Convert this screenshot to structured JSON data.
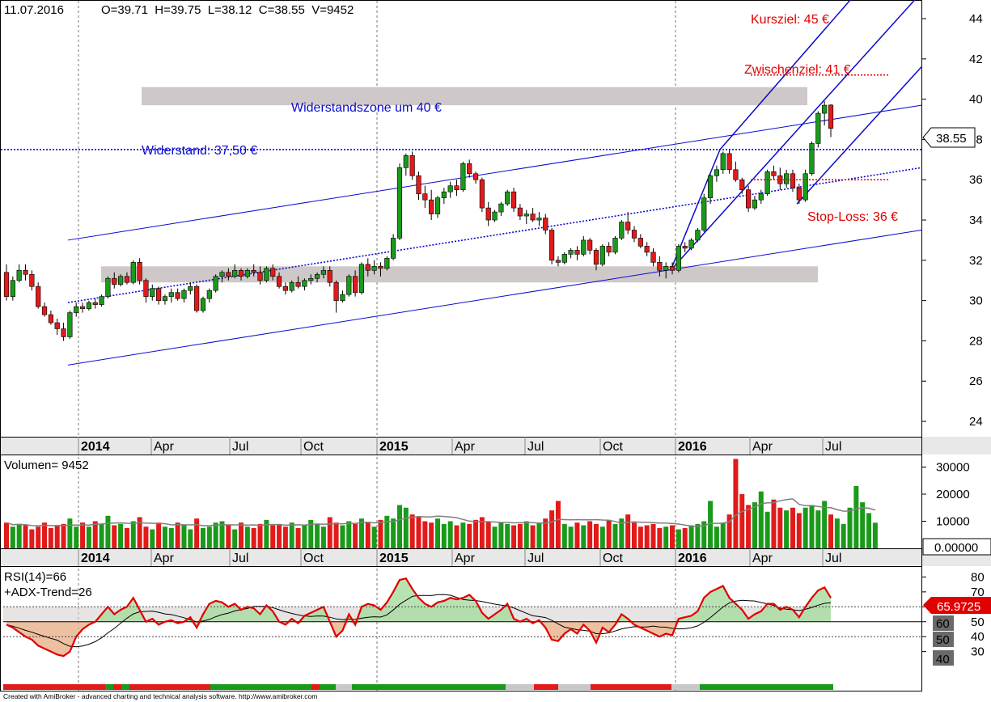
{
  "header": {
    "date": "11.07.2016",
    "ohlcv": "O=39.71  H=39.75  L=38.12  C=38.55  V=9452"
  },
  "annotations": {
    "resistance_zone": "Widerstandszone um 40 €",
    "resistance": "Widerstand: 37,50 €",
    "kursziel": "Kursziel: 45 €",
    "zwischenziel": "Zwischenziel: 41 €",
    "stop_loss": "Stop-Loss: 36 €"
  },
  "last_price_label": "38.55",
  "time_axis": {
    "labels": [
      "2014",
      "Apr",
      "Jul",
      "Oct",
      "2015",
      "Apr",
      "Jul",
      "Oct",
      "2016",
      "Apr",
      "Jul"
    ],
    "bold": [
      true,
      false,
      false,
      false,
      true,
      false,
      false,
      false,
      true,
      false,
      false
    ]
  },
  "volume_panel": {
    "title": "Volumen= 9452",
    "ticks": [
      "30000",
      "20000",
      "10000"
    ],
    "zero_label": "0.00000"
  },
  "rsi_panel": {
    "title_line1": "RSI(14)=66",
    "title_line2": "+ADX-Trend=26",
    "ticks": [
      "80",
      "70",
      "60",
      "50",
      "40",
      "30"
    ],
    "current_value": "65.9725",
    "box_labels": [
      "60",
      "50",
      "40"
    ]
  },
  "footer": "Created with AmiBroker - advanced charting and technical analysis software. http://www.amibroker.com",
  "colors": {
    "up": "#1a9a1a",
    "down": "#e21a1a",
    "channel": "#0a0ad0",
    "annotation_red": "#e00000",
    "zone": "#cfc8c8",
    "rsi": "#e00000"
  },
  "chart_data": {
    "type": "candlestick",
    "price_axis": {
      "ticks": [
        24,
        26,
        28,
        30,
        32,
        34,
        36,
        38,
        40,
        42,
        44
      ],
      "ylim": [
        23,
        45.8
      ],
      "last_close": 38.55
    },
    "ohlc_weekly_approx": [
      [
        31.4,
        31.8,
        30.0,
        30.2
      ],
      [
        30.2,
        31.2,
        30.0,
        31.0
      ],
      [
        31.0,
        31.8,
        30.9,
        31.5
      ],
      [
        31.5,
        31.8,
        31.0,
        31.3
      ],
      [
        31.3,
        31.5,
        30.5,
        30.7
      ],
      [
        30.7,
        30.9,
        29.6,
        29.7
      ],
      [
        29.7,
        29.9,
        29.2,
        29.3
      ],
      [
        29.3,
        29.5,
        28.8,
        28.9
      ],
      [
        28.9,
        29.1,
        28.3,
        28.6
      ],
      [
        28.6,
        28.9,
        28.0,
        28.2
      ],
      [
        28.2,
        29.5,
        28.1,
        29.4
      ],
      [
        29.4,
        29.9,
        29.2,
        29.7
      ],
      [
        29.7,
        29.9,
        29.4,
        29.6
      ],
      [
        29.6,
        30.0,
        29.5,
        29.9
      ],
      [
        29.9,
        30.1,
        29.6,
        29.8
      ],
      [
        29.8,
        30.3,
        29.7,
        30.2
      ],
      [
        30.2,
        31.2,
        30.1,
        31.1
      ],
      [
        31.1,
        31.4,
        30.6,
        30.8
      ],
      [
        30.8,
        31.3,
        30.7,
        31.2
      ],
      [
        31.2,
        31.4,
        30.8,
        30.9
      ],
      [
        30.9,
        32.0,
        30.8,
        31.9
      ],
      [
        31.9,
        32.1,
        30.8,
        31.0
      ],
      [
        31.0,
        31.1,
        29.9,
        30.2
      ],
      [
        30.2,
        30.8,
        30.0,
        30.6
      ],
      [
        30.6,
        30.7,
        29.8,
        30.0
      ],
      [
        30.0,
        30.3,
        29.8,
        30.2
      ],
      [
        30.2,
        30.6,
        29.9,
        30.4
      ],
      [
        30.4,
        30.6,
        30.0,
        30.1
      ],
      [
        30.1,
        30.6,
        29.9,
        30.5
      ],
      [
        30.5,
        30.9,
        30.3,
        30.7
      ],
      [
        30.7,
        30.8,
        29.4,
        29.5
      ],
      [
        29.5,
        30.2,
        29.4,
        30.1
      ],
      [
        30.1,
        30.6,
        29.9,
        30.5
      ],
      [
        30.5,
        31.3,
        30.4,
        31.2
      ],
      [
        31.2,
        31.5,
        30.9,
        31.4
      ],
      [
        31.4,
        31.6,
        31.0,
        31.2
      ],
      [
        31.2,
        31.8,
        31.1,
        31.5
      ],
      [
        31.5,
        31.6,
        31.0,
        31.2
      ],
      [
        31.2,
        31.6,
        31.1,
        31.5
      ],
      [
        31.5,
        31.8,
        31.2,
        31.4
      ],
      [
        31.4,
        31.7,
        30.8,
        31.0
      ],
      [
        31.0,
        31.7,
        30.9,
        31.6
      ],
      [
        31.6,
        31.8,
        31.0,
        31.2
      ],
      [
        31.2,
        31.4,
        30.6,
        30.7
      ],
      [
        30.7,
        30.9,
        30.3,
        30.5
      ],
      [
        30.5,
        31.0,
        30.4,
        30.9
      ],
      [
        30.9,
        31.2,
        30.6,
        30.7
      ],
      [
        30.7,
        31.1,
        30.5,
        31.0
      ],
      [
        31.0,
        31.3,
        30.8,
        31.1
      ],
      [
        31.1,
        31.4,
        30.9,
        31.3
      ],
      [
        31.3,
        31.7,
        31.1,
        31.5
      ],
      [
        31.5,
        31.7,
        30.7,
        30.9
      ],
      [
        30.9,
        31.0,
        29.4,
        30.0
      ],
      [
        30.0,
        30.5,
        29.9,
        30.3
      ],
      [
        30.3,
        31.3,
        30.2,
        31.2
      ],
      [
        31.2,
        31.5,
        30.2,
        30.4
      ],
      [
        30.4,
        31.9,
        30.3,
        31.8
      ],
      [
        31.8,
        32.1,
        31.2,
        31.5
      ],
      [
        31.5,
        32.0,
        31.3,
        31.7
      ],
      [
        31.7,
        31.9,
        31.2,
        31.6
      ],
      [
        31.6,
        32.2,
        31.5,
        32.1
      ],
      [
        32.1,
        33.3,
        32.0,
        33.1
      ],
      [
        33.1,
        36.8,
        33.0,
        36.6
      ],
      [
        36.6,
        37.3,
        36.2,
        37.2
      ],
      [
        37.2,
        37.4,
        36.0,
        36.2
      ],
      [
        36.2,
        36.4,
        35.0,
        35.3
      ],
      [
        35.3,
        35.7,
        34.6,
        35.0
      ],
      [
        35.0,
        35.5,
        34.0,
        34.3
      ],
      [
        34.3,
        35.2,
        34.1,
        35.1
      ],
      [
        35.1,
        35.6,
        34.8,
        35.4
      ],
      [
        35.4,
        35.9,
        35.1,
        35.7
      ],
      [
        35.7,
        36.0,
        35.2,
        35.5
      ],
      [
        35.5,
        36.9,
        35.4,
        36.8
      ],
      [
        36.8,
        37.0,
        36.1,
        36.3
      ],
      [
        36.3,
        36.4,
        35.8,
        36.0
      ],
      [
        36.0,
        36.1,
        34.4,
        34.6
      ],
      [
        34.6,
        34.9,
        33.7,
        34.0
      ],
      [
        34.0,
        34.5,
        33.9,
        34.4
      ],
      [
        34.4,
        34.9,
        34.2,
        34.8
      ],
      [
        34.8,
        35.5,
        34.7,
        35.4
      ],
      [
        35.4,
        35.6,
        34.4,
        34.6
      ],
      [
        34.6,
        34.8,
        34.0,
        34.2
      ],
      [
        34.2,
        34.5,
        33.8,
        34.3
      ],
      [
        34.3,
        34.6,
        33.9,
        34.0
      ],
      [
        34.0,
        34.4,
        33.7,
        34.1
      ],
      [
        34.1,
        34.3,
        33.3,
        33.5
      ],
      [
        33.5,
        33.6,
        31.8,
        32.0
      ],
      [
        32.0,
        32.2,
        31.7,
        31.9
      ],
      [
        31.9,
        32.4,
        31.8,
        32.3
      ],
      [
        32.3,
        32.6,
        32.1,
        32.5
      ],
      [
        32.5,
        32.7,
        32.0,
        32.3
      ],
      [
        32.3,
        33.2,
        32.2,
        33.0
      ],
      [
        33.0,
        33.1,
        32.3,
        32.5
      ],
      [
        32.5,
        32.6,
        31.5,
        31.8
      ],
      [
        31.8,
        32.8,
        31.7,
        32.7
      ],
      [
        32.7,
        32.9,
        32.2,
        32.4
      ],
      [
        32.4,
        33.2,
        32.3,
        33.1
      ],
      [
        33.1,
        34.0,
        33.0,
        33.9
      ],
      [
        33.9,
        34.4,
        33.3,
        33.5
      ],
      [
        33.5,
        33.7,
        32.9,
        33.1
      ],
      [
        33.1,
        33.3,
        32.6,
        32.7
      ],
      [
        32.7,
        32.9,
        32.2,
        32.4
      ],
      [
        32.4,
        32.6,
        31.7,
        31.9
      ],
      [
        31.9,
        32.2,
        31.2,
        31.5
      ],
      [
        31.5,
        31.9,
        31.1,
        31.7
      ],
      [
        31.7,
        31.9,
        31.3,
        31.5
      ],
      [
        31.5,
        32.8,
        31.4,
        32.7
      ],
      [
        32.7,
        32.9,
        32.4,
        32.6
      ],
      [
        32.6,
        33.1,
        32.5,
        33.0
      ],
      [
        33.0,
        33.6,
        32.9,
        33.5
      ],
      [
        33.5,
        35.3,
        33.4,
        35.1
      ],
      [
        35.1,
        36.3,
        34.8,
        36.2
      ],
      [
        36.2,
        36.7,
        35.9,
        36.5
      ],
      [
        36.5,
        37.4,
        36.3,
        37.3
      ],
      [
        37.3,
        37.5,
        36.3,
        36.5
      ],
      [
        36.5,
        36.9,
        35.9,
        36.0
      ],
      [
        36.0,
        36.1,
        35.3,
        35.5
      ],
      [
        35.5,
        35.7,
        34.4,
        34.6
      ],
      [
        34.6,
        35.2,
        34.5,
        35.0
      ],
      [
        35.0,
        35.5,
        34.8,
        35.3
      ],
      [
        35.3,
        36.5,
        35.2,
        36.4
      ],
      [
        36.4,
        36.7,
        36.0,
        36.2
      ],
      [
        36.2,
        36.6,
        35.5,
        35.8
      ],
      [
        35.8,
        36.5,
        35.6,
        36.3
      ],
      [
        36.3,
        36.5,
        35.4,
        35.6
      ],
      [
        35.6,
        35.8,
        34.8,
        35.0
      ],
      [
        35.0,
        36.5,
        34.9,
        36.3
      ],
      [
        36.3,
        37.9,
        36.2,
        37.8
      ],
      [
        37.8,
        39.4,
        37.6,
        39.3
      ],
      [
        39.3,
        39.9,
        38.7,
        39.7
      ],
      [
        39.71,
        39.75,
        38.12,
        38.55
      ]
    ],
    "volume_approx": [
      9500,
      8000,
      9000,
      8500,
      7000,
      8000,
      9500,
      7500,
      8500,
      9000,
      11000,
      8000,
      9500,
      8000,
      10000,
      9000,
      12000,
      8500,
      9000,
      7500,
      10000,
      11500,
      8000,
      7000,
      9500,
      8000,
      7500,
      9500,
      8500,
      7000,
      11000,
      7500,
      8000,
      9500,
      10000,
      8500,
      7000,
      9500,
      8000,
      7500,
      9000,
      10500,
      8500,
      9000,
      8000,
      9500,
      7500,
      8500,
      10500,
      9000,
      8000,
      11500,
      9500,
      8500,
      10000,
      9000,
      11000,
      9500,
      8000,
      10500,
      12000,
      11000,
      16000,
      15000,
      12500,
      11500,
      10000,
      9500,
      11000,
      9000,
      10000,
      8500,
      9500,
      9000,
      10500,
      11500,
      10000,
      8000,
      9500,
      9000,
      8500,
      9000,
      10000,
      8500,
      9500,
      11000,
      14000,
      17500,
      9000,
      8000,
      9500,
      8500,
      10000,
      9000,
      8000,
      10500,
      9000,
      11000,
      12500,
      9500,
      8000,
      8500,
      9000,
      7500,
      8000,
      8500,
      7000,
      7500,
      8500,
      9000,
      10000,
      17500,
      8000,
      9500,
      12500,
      33000,
      20000,
      16000,
      17000,
      21000,
      13500,
      18000,
      15000,
      14000,
      15000,
      13000,
      15000,
      16000,
      14000,
      17500,
      12500,
      11000,
      9000,
      15000,
      23000,
      17000,
      13000,
      9452
    ],
    "rsi14_approx": [
      48,
      46,
      43,
      40,
      38,
      34,
      32,
      30,
      28,
      27,
      30,
      40,
      45,
      48,
      50,
      55,
      60,
      55,
      58,
      60,
      66,
      58,
      50,
      52,
      48,
      50,
      51,
      49,
      50,
      53,
      46,
      55,
      62,
      64,
      63,
      60,
      62,
      58,
      60,
      59,
      55,
      61,
      57,
      50,
      48,
      52,
      49,
      54,
      56,
      58,
      60,
      50,
      40,
      44,
      55,
      48,
      60,
      62,
      61,
      58,
      63,
      70,
      78,
      79,
      72,
      66,
      62,
      60,
      63,
      64,
      66,
      65,
      66,
      68,
      64,
      56,
      52,
      55,
      58,
      62,
      52,
      50,
      52,
      49,
      51,
      46,
      38,
      37,
      42,
      45,
      42,
      48,
      44,
      36,
      46,
      43,
      48,
      55,
      52,
      48,
      46,
      44,
      42,
      40,
      42,
      41,
      52,
      53,
      54,
      57,
      66,
      70,
      72,
      74,
      66,
      62,
      58,
      52,
      55,
      57,
      62,
      62,
      58,
      60,
      58,
      53,
      60,
      66,
      71,
      73,
      66
    ],
    "rsi_thresholds": [
      50,
      60,
      40
    ],
    "notes": [
      "Widerstandszone um 40 €",
      "Widerstand: 37,50 €",
      "Kursziel: 45 €",
      "Zwischenziel: 41 €",
      "Stop-Loss: 36 €"
    ]
  }
}
